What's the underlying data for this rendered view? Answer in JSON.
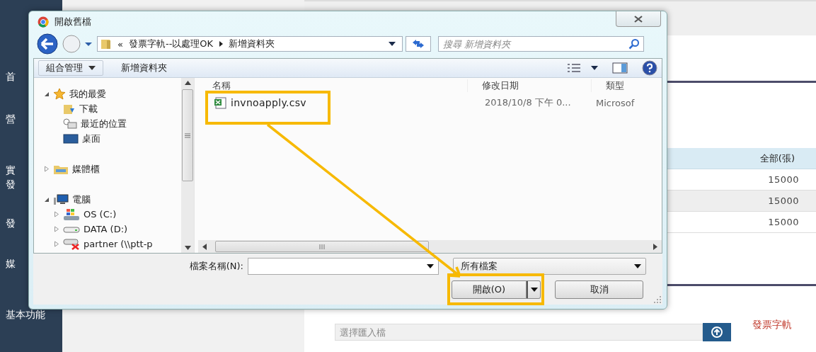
{
  "sidebar": {
    "items": [
      {
        "label": "首"
      },
      {
        "label": "營"
      },
      {
        "label": "實"
      },
      {
        "label": "發"
      },
      {
        "label": "發"
      },
      {
        "label": "媒"
      },
      {
        "label": "基本功能"
      }
    ]
  },
  "page": {
    "table": {
      "columns": [
        "全部(張)"
      ],
      "rows": [
        [
          "15000"
        ],
        [
          "15000"
        ],
        [
          "15000"
        ]
      ]
    },
    "import_field": {
      "placeholder": "選擇匯入檔"
    },
    "note": "發票字軌"
  },
  "dialog": {
    "title": "開啟舊檔",
    "address": {
      "crumbs": [
        "«",
        "發票字軌--以處理OK",
        "新增資料夾"
      ]
    },
    "search": {
      "placeholder": "搜尋 新增資料夾"
    },
    "toolbar": {
      "organize": "組合管理",
      "new_folder": "新增資料夾"
    },
    "tree": [
      {
        "label": "我的最愛",
        "kind": "favorites",
        "expanded": true,
        "children": [
          {
            "label": "下載",
            "kind": "downloads"
          },
          {
            "label": "最近的位置",
            "kind": "recent"
          },
          {
            "label": "桌面",
            "kind": "desktop"
          }
        ]
      },
      {
        "label": "媒體櫃",
        "kind": "library",
        "expanded": false
      },
      {
        "label": "電腦",
        "kind": "computer",
        "expanded": true,
        "children": [
          {
            "label": "OS (C:)",
            "kind": "system-drive",
            "expanded": false
          },
          {
            "label": "DATA (D:)",
            "kind": "drive",
            "expanded": false
          },
          {
            "label": "partner (\\\\ptt-p",
            "kind": "network-drive",
            "expanded": false
          }
        ]
      }
    ],
    "columns": [
      "名稱",
      "修改日期",
      "類型"
    ],
    "files": [
      {
        "name": "invnoapply.csv",
        "modified": "2018/10/8 下午 0...",
        "type": "Microsof"
      }
    ],
    "file_name": {
      "label": "檔案名稱(N):"
    },
    "file_type": "所有檔案",
    "buttons": {
      "open": "開啟(O)",
      "cancel": "取消"
    }
  }
}
